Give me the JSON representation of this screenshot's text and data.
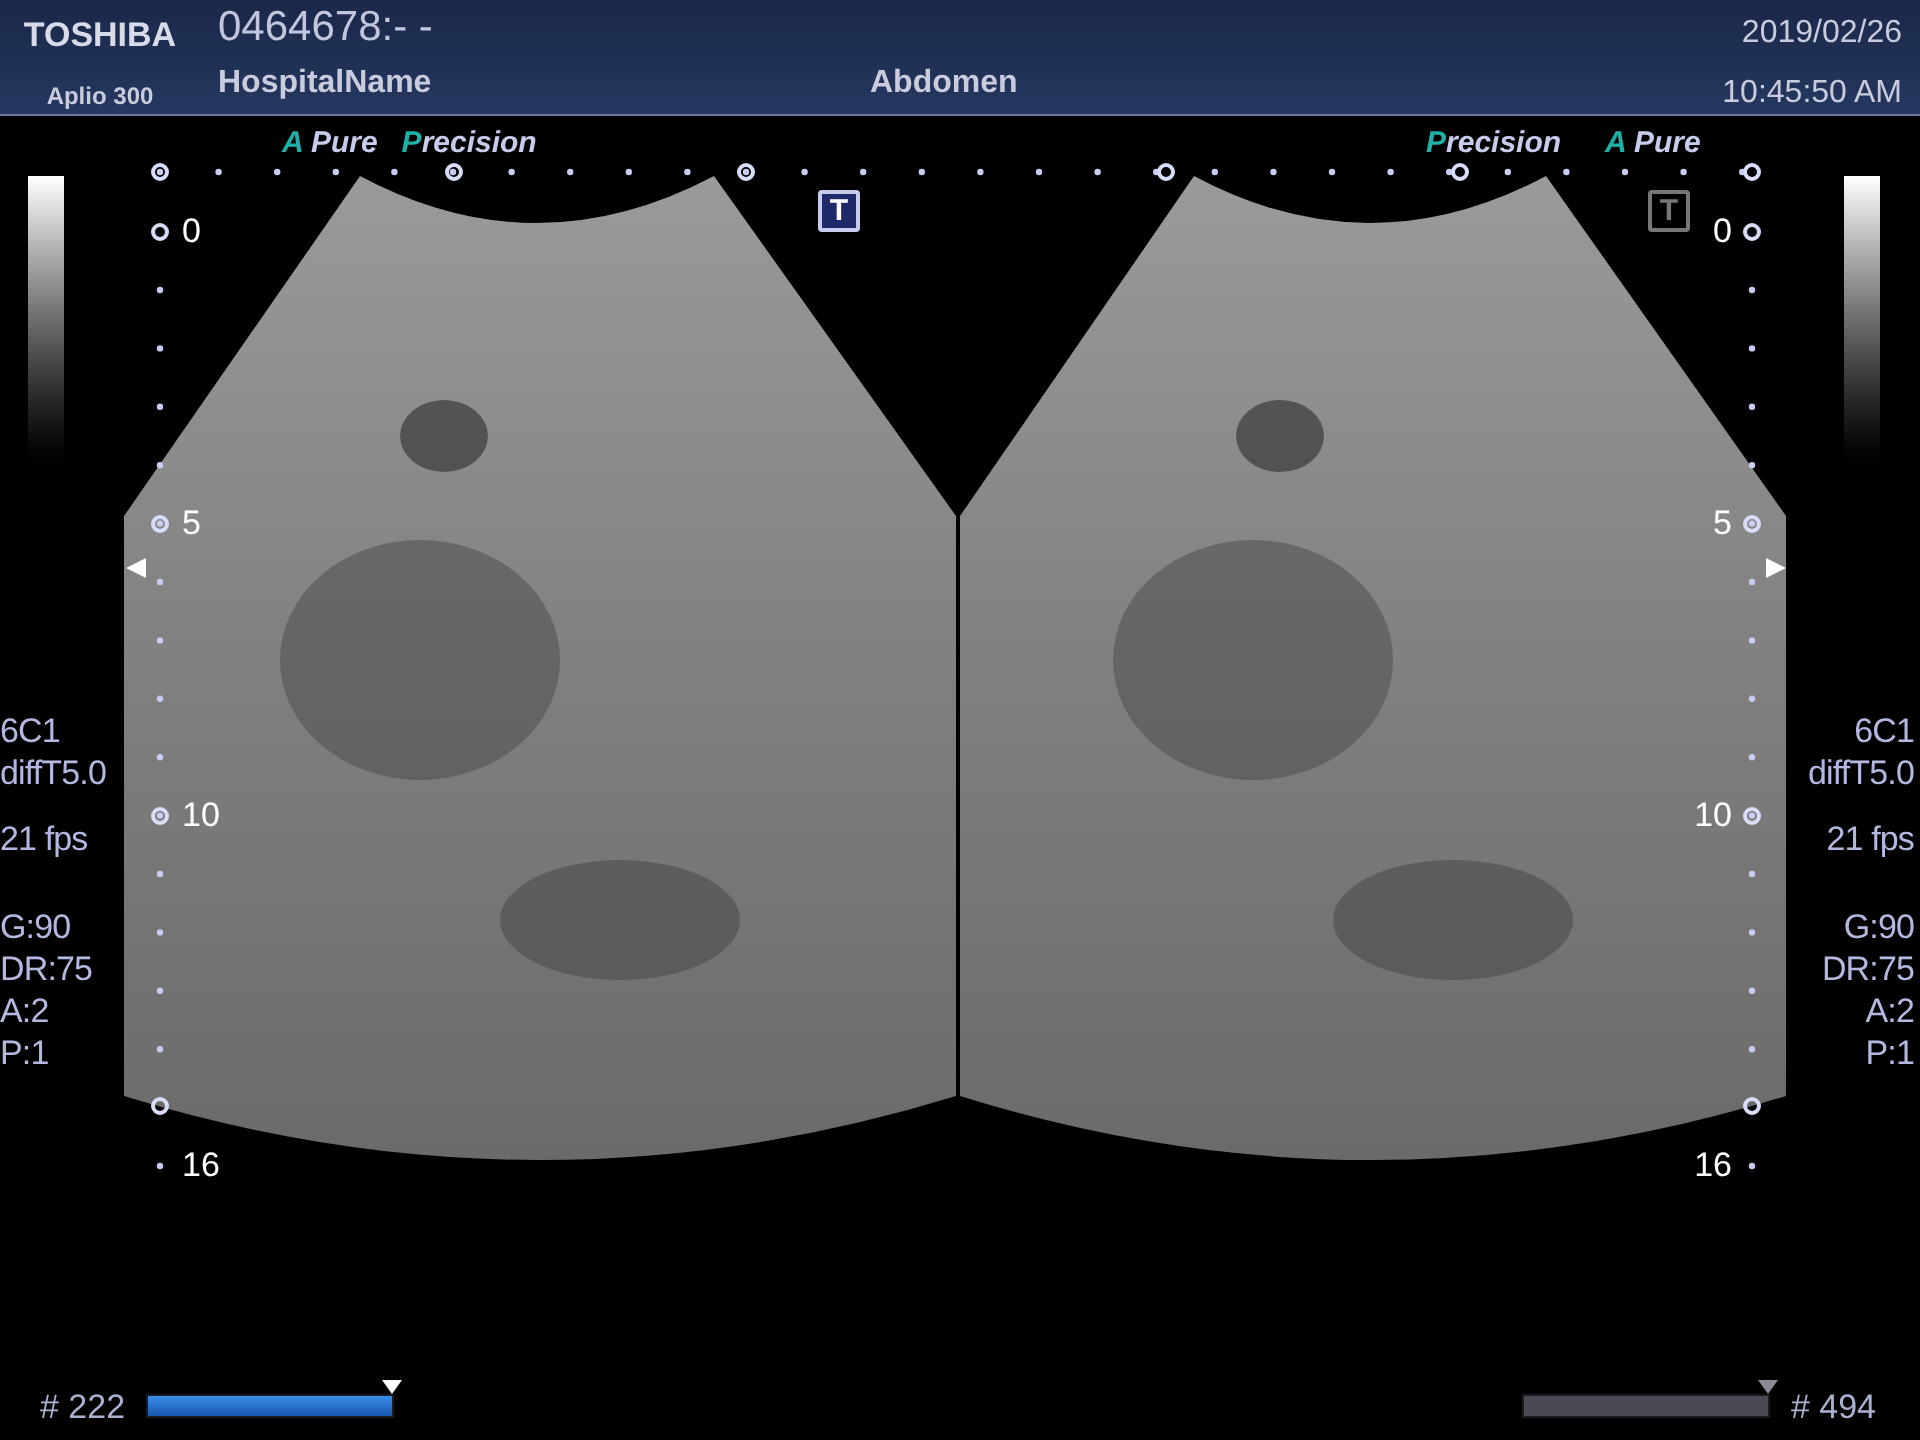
{
  "header": {
    "brand": "TOSHIBA",
    "model": "Aplio 300",
    "patient_id": "0464678:- -",
    "hospital": "HospitalName",
    "preset": "Abdomen",
    "date": "2019/02/26",
    "time": "10:45:50 AM"
  },
  "panels": [
    {
      "labels": [
        "A Pure",
        "Precision"
      ],
      "t_marker": {
        "text": "T",
        "selected": true
      },
      "depth_labels": [
        "0",
        "5",
        "10",
        "16"
      ],
      "params": {
        "probe": "6C1",
        "mode": "diffT5.0",
        "frame_rate": "21 fps",
        "settings": [
          "G:90",
          "DR:75",
          "A:2",
          "P:1"
        ]
      },
      "cine": {
        "frame": "# 222",
        "active": true,
        "level": 1
      }
    },
    {
      "labels": [
        "Precision",
        "A Pure"
      ],
      "t_marker": {
        "text": "T",
        "selected": false
      },
      "depth_labels": [
        "0",
        "5",
        "10",
        "16"
      ],
      "params": {
        "probe": "6C1",
        "mode": "diffT5.0",
        "frame_rate": "21 fps",
        "settings": [
          "G:90",
          "DR:75",
          "A:2",
          "P:1"
        ]
      },
      "cine": {
        "frame": "# 494",
        "active": false,
        "level": 1
      }
    }
  ]
}
